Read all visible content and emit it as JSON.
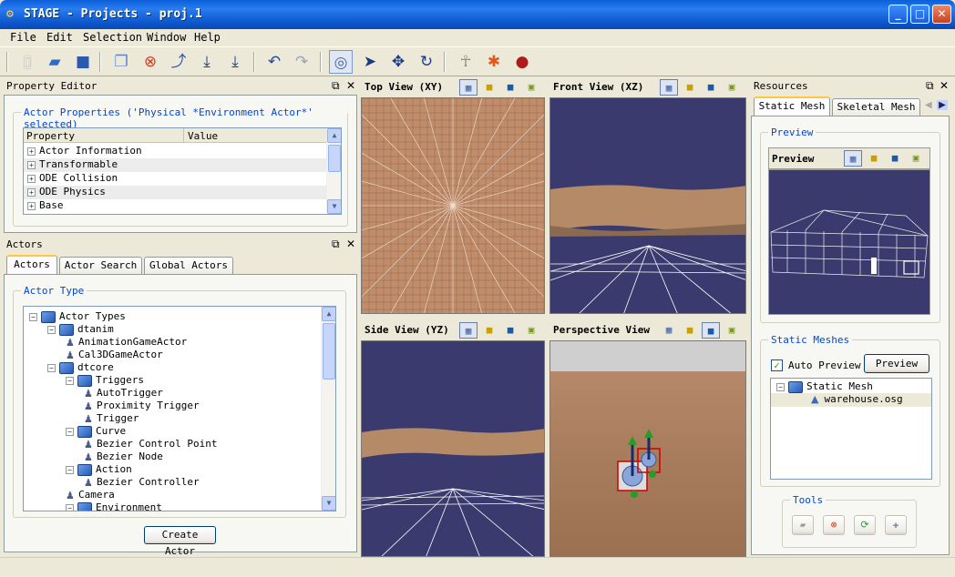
{
  "window": {
    "title": "STAGE - Projects - proj.1"
  },
  "menu": [
    "File",
    "Edit",
    "Selection",
    "Window",
    "Help"
  ],
  "property_editor": {
    "title": "Property Editor",
    "group_label": "Actor Properties ('Physical *Environment Actor*' selected)",
    "columns": [
      "Property",
      "Value"
    ],
    "rows": [
      "Actor Information",
      "Transformable",
      "ODE Collision",
      "ODE Physics",
      "Base"
    ]
  },
  "actors": {
    "title": "Actors",
    "tabs": [
      "Actors",
      "Actor Search",
      "Global Actors"
    ],
    "group_label": "Actor Type",
    "tree": [
      {
        "label": "Actor Types",
        "kind": "folder",
        "indent": 0
      },
      {
        "label": "dtanim",
        "kind": "folder",
        "indent": 1
      },
      {
        "label": "AnimationGameActor",
        "kind": "actor",
        "indent": 2
      },
      {
        "label": "Cal3DGameActor",
        "kind": "actor",
        "indent": 2
      },
      {
        "label": "dtcore",
        "kind": "folder",
        "indent": 1
      },
      {
        "label": "Triggers",
        "kind": "folder",
        "indent": 2
      },
      {
        "label": "AutoTrigger",
        "kind": "actor",
        "indent": 3
      },
      {
        "label": "Proximity Trigger",
        "kind": "actor",
        "indent": 3
      },
      {
        "label": "Trigger",
        "kind": "actor",
        "indent": 3
      },
      {
        "label": "Curve",
        "kind": "folder",
        "indent": 2
      },
      {
        "label": "Bezier Control Point",
        "kind": "actor",
        "indent": 3
      },
      {
        "label": "Bezier Node",
        "kind": "actor",
        "indent": 3
      },
      {
        "label": "Action",
        "kind": "folder",
        "indent": 2
      },
      {
        "label": "Bezier Controller",
        "kind": "actor",
        "indent": 3
      },
      {
        "label": "Camera",
        "kind": "actor",
        "indent": 2
      },
      {
        "label": "Environment",
        "kind": "folder",
        "indent": 2
      }
    ],
    "create_button": "Create Actor"
  },
  "viewports": {
    "top": "Top View (XY)",
    "front": "Front View (XZ)",
    "side": "Side View (YZ)",
    "perspective": "Perspective View"
  },
  "resources": {
    "title": "Resources",
    "tabs": [
      "Static Mesh",
      "Skeletal Mesh"
    ],
    "preview_group": "Preview",
    "preview_title": "Preview",
    "static_group": "Static Meshes",
    "auto_preview_label": "Auto Preview",
    "auto_preview_checked": true,
    "preview_button": "Preview",
    "tree": [
      {
        "label": "Static Mesh",
        "kind": "folder"
      },
      {
        "label": "warehouse.osg",
        "kind": "mesh"
      }
    ],
    "tools_label": "Tools"
  },
  "colors": {
    "sky": "#3a3a6e",
    "sand": "#b58a66",
    "accent": "#0046d5"
  }
}
